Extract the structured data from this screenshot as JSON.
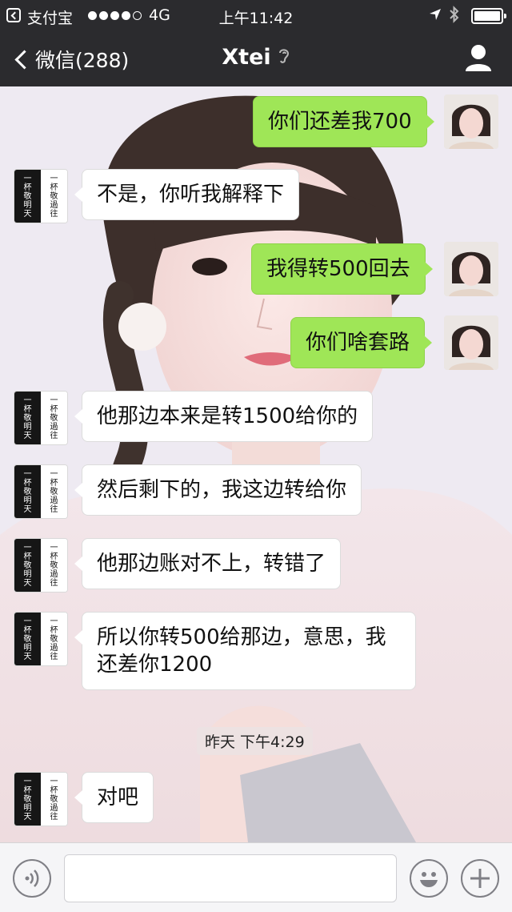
{
  "status_bar": {
    "carrier": "支付宝",
    "signal_dots": 5,
    "signal_filled": 4,
    "network": "4G",
    "time": "上午11:42",
    "location_icon": "location-arrow-icon",
    "bluetooth_icon": "bluetooth-icon",
    "battery_icon": "battery-icon"
  },
  "nav": {
    "back_label": "微信(288)",
    "title": "Xtei",
    "ear_icon": "ear-icon",
    "profile_icon": "profile-icon"
  },
  "avatars": {
    "contact_dark_text": [
      "一",
      "杯",
      "敬",
      "明",
      "天"
    ],
    "contact_light_text": [
      "一",
      "杯",
      "敬",
      "過",
      "往"
    ]
  },
  "messages": [
    {
      "side": "out",
      "text": "你们还差我700"
    },
    {
      "side": "in",
      "text": "不是，你听我解释下"
    },
    {
      "side": "out",
      "text": "我得转500回去"
    },
    {
      "side": "out",
      "text": "你们啥套路"
    },
    {
      "side": "in",
      "text": "他那边本来是转1500给你的"
    },
    {
      "side": "in",
      "text": "然后剩下的，我这边转给你"
    },
    {
      "side": "in",
      "text": "他那边账对不上，转错了"
    },
    {
      "side": "in",
      "text": "所以你转500给那边，意思，我\n还差你1200"
    },
    {
      "side": "in",
      "text": "对吧"
    }
  ],
  "timestamp": "昨天 下午4:29",
  "input_bar": {
    "voice_icon": "voice-icon",
    "emoji_icon": "emoji-icon",
    "plus_icon": "plus-icon",
    "placeholder": ""
  },
  "colors": {
    "bar_bg": "#2b2b2e",
    "bubble_out": "#9fe657",
    "bubble_in": "#ffffff"
  }
}
